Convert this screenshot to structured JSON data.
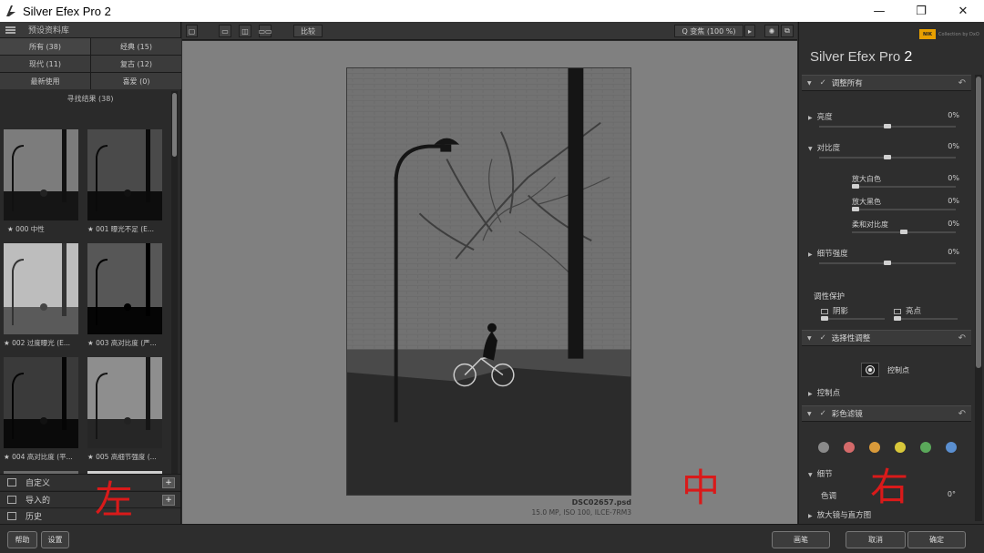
{
  "window": {
    "title": "Silver Efex Pro 2",
    "minimize": "—",
    "maximize": "❐",
    "close": "✕"
  },
  "left_panel": {
    "header": "预设资料库",
    "categories": [
      {
        "label": "所有 (38)"
      },
      {
        "label": "经典 (15)"
      },
      {
        "label": "现代 (11)"
      },
      {
        "label": "复古 (12)"
      },
      {
        "label": "最新使用"
      },
      {
        "label": "喜爱 (0)"
      }
    ],
    "results_title": "寻找结果 (38)",
    "presets": [
      {
        "label": "★ 000 中性"
      },
      {
        "label": "★ 001 曝光不足 (E..."
      },
      {
        "label": "★ 002 过度曝光 (E..."
      },
      {
        "label": "★ 003 高对比度 (严..."
      },
      {
        "label": "★ 004 高对比度 (平..."
      },
      {
        "label": "★ 005 高细节强度 (..."
      }
    ],
    "sections": [
      {
        "label": "自定义",
        "plus": "+"
      },
      {
        "label": "导入的",
        "plus": "+"
      },
      {
        "label": "历史"
      }
    ],
    "annotation": "左"
  },
  "toolbar": {
    "compare": "比较",
    "zoom": "Q 变焦 (100 %)",
    "zoom_arrow": "▸"
  },
  "preview": {
    "file_name": "DSC02657.psd",
    "file_meta": "15.0 MP, ISO 100, ILCE-7RM3",
    "annotation": "中"
  },
  "right_panel": {
    "brand_badge": "NIK",
    "brand_text": "Collection by DxO",
    "product_name": "Silver Efex Pro",
    "product_version": "2",
    "sections": {
      "adjust_all": "调整所有",
      "selective": "选择性调整",
      "color_filter": "彩色滤镜"
    },
    "rows": {
      "brightness": {
        "label": "亮度",
        "value": "0%"
      },
      "contrast": {
        "label": "对比度",
        "value": "0%"
      },
      "amplify_whites": {
        "label": "放大白色",
        "value": "0%"
      },
      "amplify_blacks": {
        "label": "放大黑色",
        "value": "0%"
      },
      "soft_contrast": {
        "label": "柔和对比度",
        "value": "0%"
      },
      "structure": {
        "label": "细节强度",
        "value": "0%"
      }
    },
    "tonality_protection": "调性保护",
    "shadows": "阴影",
    "highlights": "亮点",
    "control_point_button": "控制点",
    "control_points": "控制点",
    "details": "细节",
    "hue": {
      "label": "色调",
      "value": "0°"
    },
    "loupe": "放大镜与直方图",
    "filter_colors": [
      "#8a8a8a",
      "#d46a6a",
      "#d99a3a",
      "#d8c73a",
      "#5aa85a",
      "#5a8fd0"
    ],
    "annotation": "右"
  },
  "bottom_bar": {
    "help": "帮助",
    "settings": "设置",
    "brush": "画笔",
    "cancel": "取消",
    "ok": "确定"
  }
}
